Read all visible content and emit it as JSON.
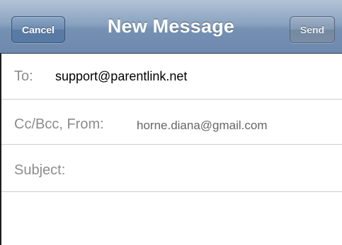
{
  "navbar": {
    "title": "New Message",
    "cancel_label": "Cancel",
    "send_label": "Send"
  },
  "fields": {
    "to_label": "To:",
    "to_value": "support@parentlink.net",
    "cc_from_label": "Cc/Bcc, From:",
    "from_value": "horne.diana@gmail.com",
    "subject_label": "Subject:"
  },
  "colors": {
    "navbar_blue": "#7590b3",
    "label_gray": "#8c8c8c",
    "divider": "#cdcdcd"
  }
}
